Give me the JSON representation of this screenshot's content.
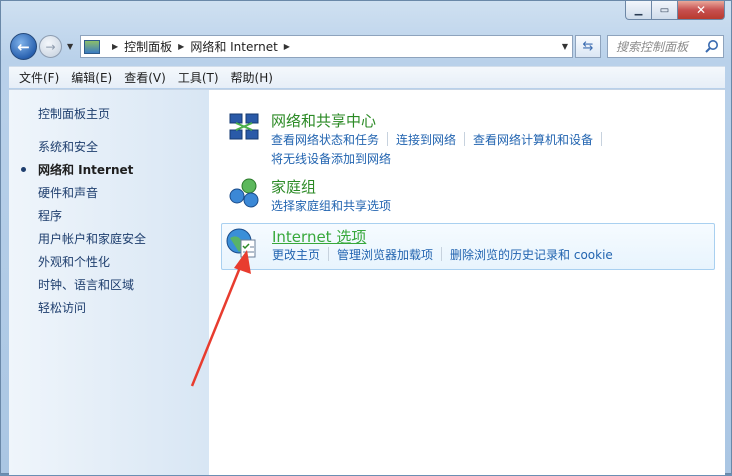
{
  "nav": {
    "breadcrumb": [
      "控制面板",
      "网络和 Internet"
    ],
    "search_placeholder": "搜索控制面板"
  },
  "menu": [
    "文件(F)",
    "编辑(E)",
    "查看(V)",
    "工具(T)",
    "帮助(H)"
  ],
  "sidebar": {
    "home": "控制面板主页",
    "items": [
      "系统和安全",
      "网络和 Internet",
      "硬件和声音",
      "程序",
      "用户帐户和家庭安全",
      "外观和个性化",
      "时钟、语言和区域",
      "轻松访问"
    ],
    "active_index": 1
  },
  "categories": [
    {
      "title": "网络和共享中心",
      "links": [
        "查看网络状态和任务",
        "连接到网络",
        "查看网络计算机和设备"
      ],
      "links2": [
        "将无线设备添加到网络"
      ]
    },
    {
      "title": "家庭组",
      "links": [
        "选择家庭组和共享选项"
      ]
    },
    {
      "title": "Internet 选项",
      "links": [
        "更改主页",
        "管理浏览器加载项",
        "删除浏览的历史记录和 cookie"
      ]
    }
  ],
  "colors": {
    "link": "#2264b0",
    "category_title": "#2b8a25",
    "annotation_arrow": "#e83c2f"
  },
  "icons": [
    "back-arrow-icon",
    "forward-arrow-icon",
    "refresh-icon",
    "search-icon",
    "network-sharing-icon",
    "homegroup-icon",
    "internet-options-icon"
  ]
}
